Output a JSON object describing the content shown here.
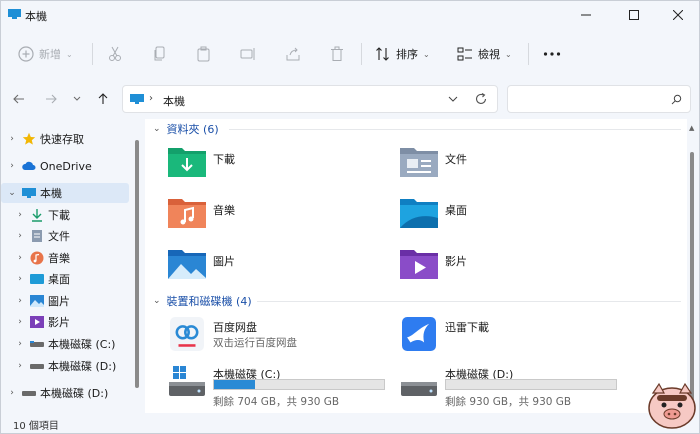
{
  "window": {
    "title": "本機"
  },
  "toolbar": {
    "new_label": "新增",
    "sort_label": "排序",
    "view_label": "檢視"
  },
  "address": {
    "crumb": "本機",
    "search_placeholder": ""
  },
  "sidebar": {
    "items": [
      {
        "label": "快速存取"
      },
      {
        "label": "OneDrive"
      },
      {
        "label": "本機"
      },
      {
        "label": "下載"
      },
      {
        "label": "文件"
      },
      {
        "label": "音樂"
      },
      {
        "label": "桌面"
      },
      {
        "label": "圖片"
      },
      {
        "label": "影片"
      },
      {
        "label": "本機磁碟 (C:)"
      },
      {
        "label": "本機磁碟 (D:)"
      },
      {
        "label": "本機磁碟 (D:)"
      }
    ]
  },
  "groups": {
    "folders_label": "資料夾 (6)",
    "devices_label": "裝置和磁碟機 (4)"
  },
  "folders": [
    {
      "name": "下載"
    },
    {
      "name": "文件"
    },
    {
      "name": "音樂"
    },
    {
      "name": "桌面"
    },
    {
      "name": "圖片"
    },
    {
      "name": "影片"
    }
  ],
  "devices": [
    {
      "name": "百度网盘",
      "sub": "双击运行百度网盘"
    },
    {
      "name": "迅雷下載"
    },
    {
      "name": "本機磁碟 (C:)",
      "free": "剩餘 704 GB，共 930 GB",
      "used_fraction": 0.243
    },
    {
      "name": "本機磁碟 (D:)",
      "free": "剩餘 930 GB，共 930 GB",
      "used_fraction": 0.0
    }
  ],
  "status": {
    "count": "10 個項目"
  },
  "colors": {
    "accent": "#1a4fa8",
    "selection": "#dce8f7",
    "drive_fill": "#2a8ad5"
  }
}
